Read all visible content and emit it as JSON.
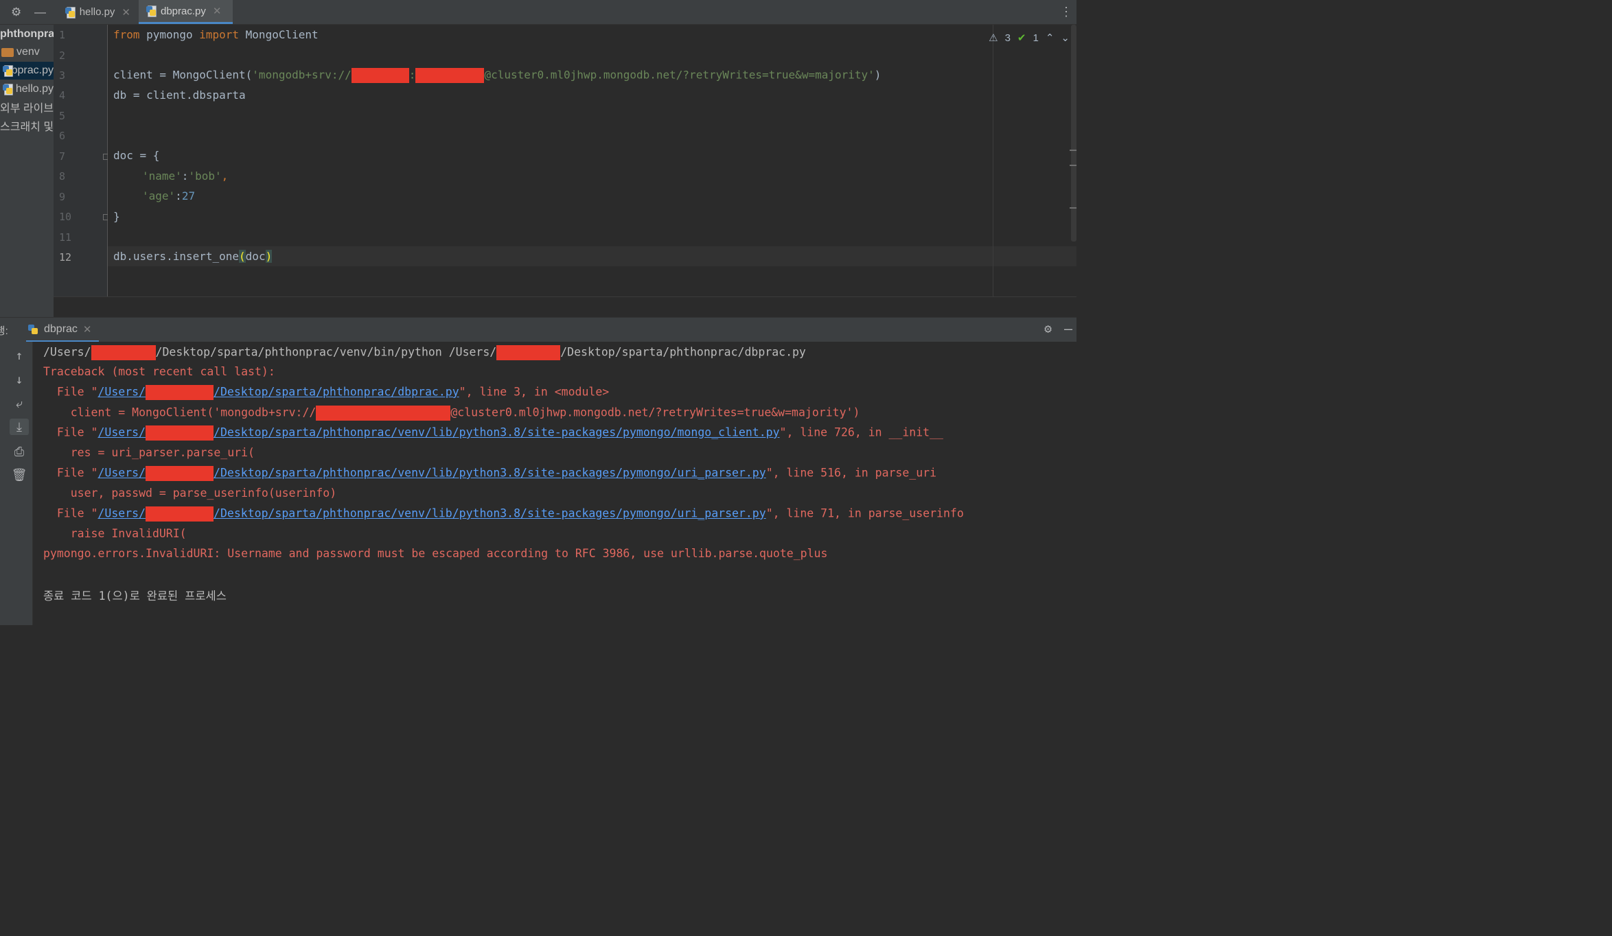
{
  "tabs": [
    {
      "label": "hello.py",
      "active": false
    },
    {
      "label": "dbprac.py",
      "active": true
    }
  ],
  "sidebar": {
    "root": "phthonprac",
    "items": [
      "venv",
      "dbprac.py",
      "hello.py",
      "외부 라이브러리",
      "스크래치 및 콘솔"
    ]
  },
  "editor": {
    "line_numbers": [
      "1",
      "2",
      "3",
      "4",
      "5",
      "6",
      "7",
      "8",
      "9",
      "10",
      "11",
      "12"
    ],
    "current_line": "12",
    "lines": {
      "l1_kw1": "from",
      "l1_mod": " pymongo ",
      "l1_kw2": "import",
      "l1_name": " MongoClient",
      "l3_pre": "client = MongoClient(",
      "l3_str1": "'mongodb+srv://",
      "l3_colon": ":",
      "l3_str2": "@cluster0.ml0jhwp.mongodb.net/?retryWrites=true&w=majority'",
      "l3_post": ")",
      "l4": "db = client.dbsparta",
      "l7": "doc = {",
      "l8_key": "'name'",
      "l8_sep": ":",
      "l8_val": "'bob'",
      "l8_end": ",",
      "l9_key": "'age'",
      "l9_sep": ":",
      "l9_val": "27",
      "l10": "}",
      "l12_pre": "db.users.insert_one",
      "l12_open": "(",
      "l12_arg": "doc",
      "l12_close": ")"
    },
    "inspections": {
      "warnings": "3",
      "ok": "1"
    }
  },
  "run_panel": {
    "label": "실행:",
    "tab": "dbprac",
    "console": {
      "cmd_a": "/Users/",
      "cmd_b": "/Desktop/sparta/phthonprac/venv/bin/python /Users/",
      "cmd_c": "/Desktop/sparta/phthonprac/dbprac.py",
      "traceback": "Traceback (most recent call last):",
      "f1_pre": "  File \"",
      "f1_a": "/Users/",
      "f1_b": "/Desktop/sparta/phthonprac/dbprac.py",
      "f1_post": "\", line 3, in <module>",
      "c1_a": "    client = MongoClient('mongodb+srv://",
      "c1_b": "@cluster0.ml0jhwp.mongodb.net/?retryWrites=true&w=majority')",
      "f2_pre": "  File \"",
      "f2_a": "/Users/",
      "f2_b": "/Desktop/sparta/phthonprac/venv/lib/python3.8/site-packages/pymongo/mongo_client.py",
      "f2_post": "\", line 726, in __init__",
      "c2": "    res = uri_parser.parse_uri(",
      "f3_pre": "  File \"",
      "f3_a": "/Users/",
      "f3_b": "/Desktop/sparta/phthonprac/venv/lib/python3.8/site-packages/pymongo/uri_parser.py",
      "f3_post": "\", line 516, in parse_uri",
      "c3": "    user, passwd = parse_userinfo(userinfo)",
      "f4_pre": "  File \"",
      "f4_a": "/Users/",
      "f4_b": "/Desktop/sparta/phthonprac/venv/lib/python3.8/site-packages/pymongo/uri_parser.py",
      "f4_post": "\", line 71, in parse_userinfo",
      "c4": "    raise InvalidURI(",
      "error": "pymongo.errors.InvalidURI: Username and password must be escaped according to RFC 3986, use urllib.parse.quote_plus",
      "exit": "종료 코드 1(으)로 완료된 프로세스"
    }
  },
  "icons": {
    "settings": "gear-icon",
    "minimize": "minus-icon",
    "more": "more-vertical-icon",
    "python_file": "python-file-icon",
    "folder": "folder-icon",
    "up": "arrow-up-icon",
    "down": "arrow-down-icon",
    "wrap": "soft-wrap-icon",
    "scroll_end": "scroll-to-end-icon",
    "print": "print-icon",
    "trash": "trash-icon"
  },
  "colors": {
    "keyword": "#cc7832",
    "string": "#6a8759",
    "number": "#6897bb",
    "error": "#e0685f",
    "link": "#589df6",
    "redaction": "#e8382b"
  }
}
